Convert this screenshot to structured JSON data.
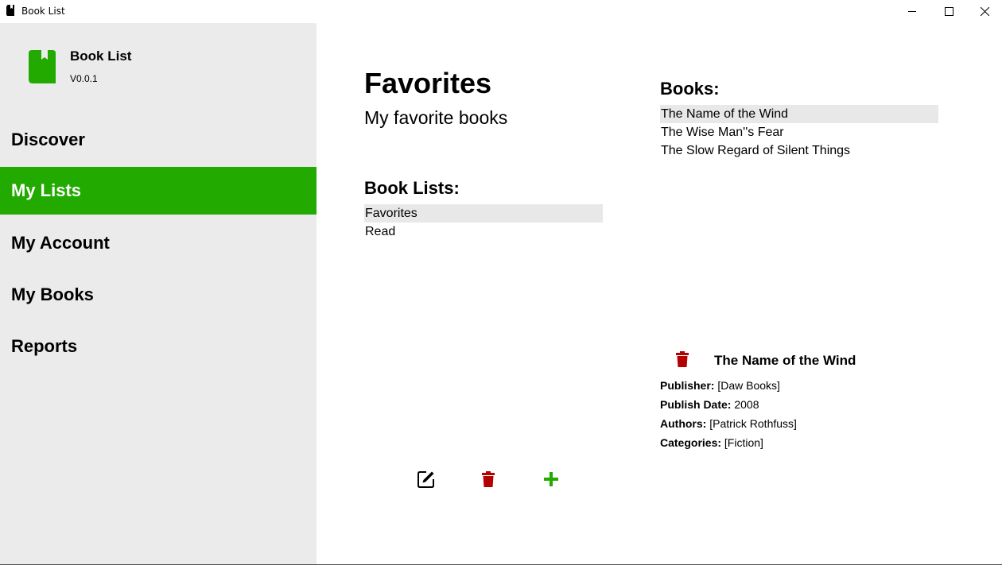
{
  "window": {
    "title": "Book List",
    "icons": {
      "app": "book-icon",
      "minimize": "minimize-icon",
      "maximize": "maximize-icon",
      "close": "close-icon"
    }
  },
  "sidebar": {
    "brand_name": "Book List",
    "version": "V0.0.1",
    "brand_icon": "book-bookmark-icon",
    "accent_color": "#22aa00",
    "items": [
      {
        "label": "Discover",
        "active": false
      },
      {
        "label": "My Lists",
        "active": true
      },
      {
        "label": "My Account",
        "active": false
      },
      {
        "label": "My Books",
        "active": false
      },
      {
        "label": "Reports",
        "active": false
      }
    ]
  },
  "main": {
    "title": "Favorites",
    "subtitle": "My favorite books",
    "book_lists": {
      "heading": "Book Lists:",
      "items": [
        "Favorites",
        "Read"
      ],
      "selected": "Favorites"
    },
    "books": {
      "heading": "Books:",
      "items": [
        "The Name of the Wind",
        "The Wise Man''s Fear",
        "The Slow Regard of Silent Things"
      ],
      "selected": "The Name of the Wind"
    },
    "toolbar": {
      "edit_icon": "edit-icon",
      "delete_icon": "trash-icon",
      "add_icon": "plus-icon",
      "delete_color": "#b30000",
      "add_color": "#22aa00"
    },
    "detail": {
      "title": "The Name of the Wind",
      "delete_icon": "trash-icon",
      "publisher_label": "Publisher:",
      "publisher": "[Daw Books]",
      "date_label": "Publish Date:",
      "date": "2008",
      "authors_label": "Authors:",
      "authors": "[Patrick Rothfuss]",
      "categories_label": "Categories:",
      "categories": "[Fiction]"
    }
  }
}
